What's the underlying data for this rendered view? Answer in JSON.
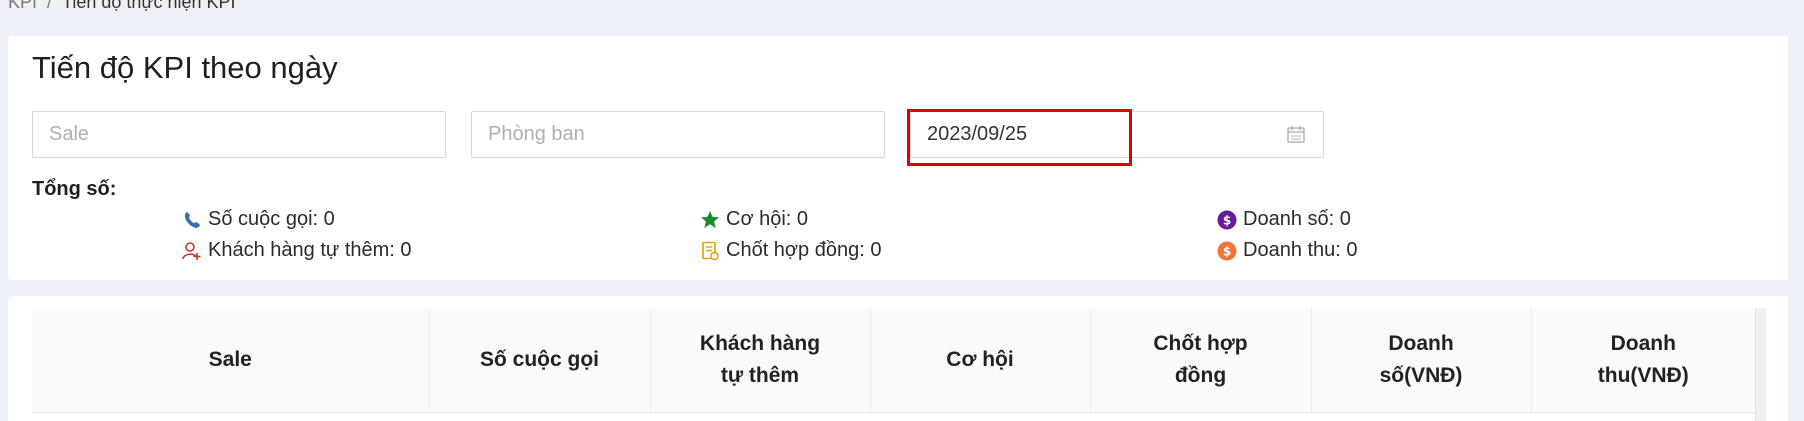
{
  "breadcrumb": {
    "root": "KPI",
    "separator": "/",
    "current": "Tiến độ thực hiện KPI"
  },
  "filter": {
    "title": "Tiến độ KPI theo ngày",
    "sale_placeholder": "Sale",
    "department_placeholder": "Phòng ban",
    "date_value": "2023/09/25"
  },
  "totals": {
    "label": "Tổng số:",
    "calls": "Số cuộc gọi: 0",
    "customers_added": "Khách hàng tự thêm: 0",
    "opportunities": "Cơ hội: 0",
    "contracts_closed": "Chốt hợp đồng: 0",
    "sales": "Doanh số: 0",
    "revenue": "Doanh thu: 0"
  },
  "table": {
    "headers": [
      "Sale",
      "Số cuộc gọi",
      "Khách hàng tự thêm",
      "Cơ hội",
      "Chốt hợp đồng",
      "Doanh số(VNĐ)",
      "Doanh thu(VNĐ)"
    ]
  },
  "colors": {
    "highlight": "#e10000",
    "phone_icon": "#3d6fb6",
    "star_icon": "#1a8c2a",
    "sales_icon": "#6a1b9a",
    "revenue_icon": "#f4743b"
  },
  "icons": [
    "phone-icon",
    "user-add-icon",
    "star-icon",
    "contract-icon",
    "dollar-circle-icon",
    "calendar-icon"
  ]
}
